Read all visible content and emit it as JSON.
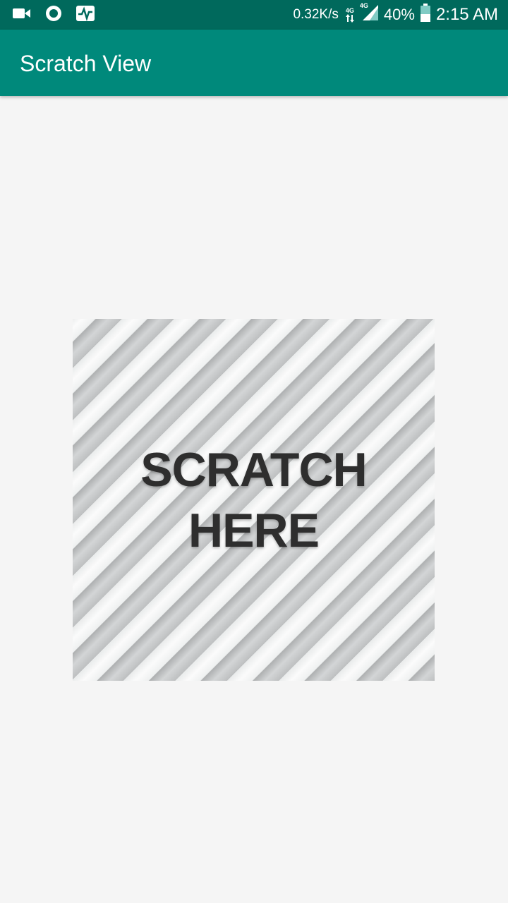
{
  "status_bar": {
    "icons_left": [
      "video-camera-icon",
      "record-circle-icon",
      "activity-monitor-icon"
    ],
    "network_speed": "0.32K/s",
    "network_type_1": "4G",
    "network_type_2": "4G",
    "battery_percent": "40%",
    "battery_level": 0.4,
    "time": "2:15 AM"
  },
  "app_bar": {
    "title": "Scratch View"
  },
  "scratch_card": {
    "line1": "SCRATCH",
    "line2": "HERE"
  },
  "colors": {
    "status_bar": "#00695c",
    "app_bar": "#00897b",
    "background": "#f5f5f5",
    "scratch_text": "#2e2e2e"
  }
}
